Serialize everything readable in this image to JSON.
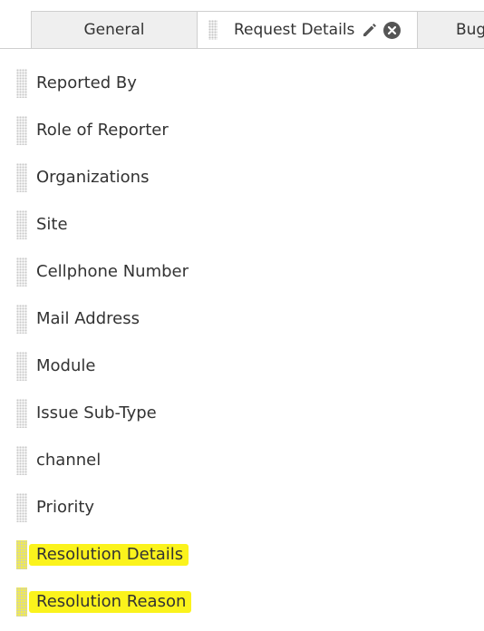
{
  "tabs": {
    "general": {
      "label": "General"
    },
    "request_details": {
      "label": "Request Details"
    },
    "bug": {
      "label": "Bug"
    }
  },
  "icons": {
    "edit": "pencil-icon",
    "close": "close-circle-icon",
    "drag": "drag-handle-icon"
  },
  "colors": {
    "highlight": "#fbf31c",
    "text": "#333333",
    "inactive_tab": "#efefef"
  },
  "fields": [
    {
      "label": "Reported By",
      "highlighted": false
    },
    {
      "label": "Role of Reporter",
      "highlighted": false
    },
    {
      "label": "Organizations",
      "highlighted": false
    },
    {
      "label": "Site",
      "highlighted": false
    },
    {
      "label": "Cellphone Number",
      "highlighted": false
    },
    {
      "label": "Mail Address",
      "highlighted": false
    },
    {
      "label": "Module",
      "highlighted": false
    },
    {
      "label": "Issue Sub-Type",
      "highlighted": false
    },
    {
      "label": "channel",
      "highlighted": false
    },
    {
      "label": "Priority",
      "highlighted": false
    },
    {
      "label": "Resolution Details",
      "highlighted": true
    },
    {
      "label": "Resolution Reason",
      "highlighted": true
    }
  ]
}
